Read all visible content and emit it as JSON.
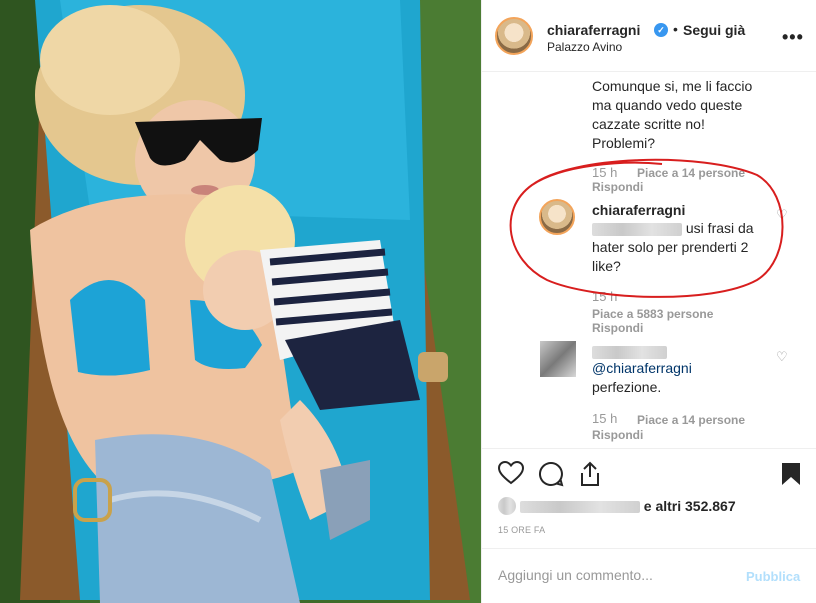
{
  "header": {
    "username": "chiaraferragni",
    "separator": "•",
    "follow_label": "Segui già",
    "location": "Palazzo Avino",
    "more_label": "•••"
  },
  "comments": [
    {
      "text_lines": [
        "Comunque si, me li faccio",
        "ma quando vedo queste",
        "cazzate scritte no!",
        "Problemi?"
      ],
      "time": "15 h",
      "likes": "Piace a 14 persone",
      "reply": "Rispondi"
    },
    {
      "username": "chiaraferragni",
      "text_line1_rest": "usi frasi da",
      "text_line2": "hater solo per prenderti 2",
      "text_line3": "like?",
      "time": "15 h",
      "likes": "Piace a 5883 persone",
      "reply": "Rispondi"
    },
    {
      "mention": "@chiaraferragni",
      "text": "perfezione.",
      "time": "15 h",
      "likes": "Piace a 14 persone",
      "reply": "Rispondi"
    }
  ],
  "actions": {
    "likes_suffix": "e altri 352.867",
    "time_ago": "15 ORE FA"
  },
  "add_comment": {
    "placeholder": "Aggiungi un commento...",
    "publish_label": "Pubblica"
  },
  "colors": {
    "verified": "#3897f0",
    "publish_disabled": "#b2dffc",
    "annotation_red": "#d81e1e"
  },
  "icons": [
    "heart-icon",
    "comment-icon",
    "share-icon",
    "bookmark-icon",
    "more-icon",
    "verified-icon"
  ]
}
